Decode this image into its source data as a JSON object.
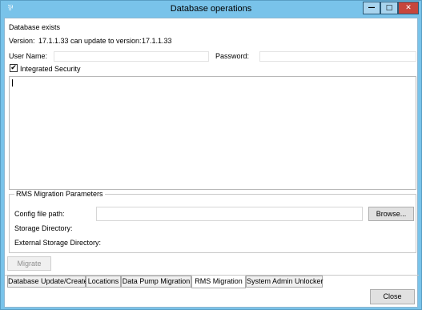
{
  "window": {
    "title": "Database operations",
    "icon_glyph": "⅌",
    "controls": {
      "minimize": "—",
      "maximize": "□",
      "close": "✕"
    }
  },
  "status": {
    "text": "Database exists",
    "version_label": "Version:",
    "version": "17.1.1.33",
    "update_label": "can update to version:",
    "update_version": "17.1.1.33"
  },
  "credentials": {
    "user_name_label": "User Name:",
    "user_name_value": "",
    "password_label": "Password:",
    "password_value": "",
    "integrated_security_label": "Integrated Security",
    "integrated_security_checked": true,
    "check_glyph": "✔"
  },
  "log": {
    "text": ""
  },
  "rms": {
    "group_title": "RMS Migration Parameters",
    "config_path_label": "Config file path:",
    "config_path_value": "",
    "browse_label": "Browse...",
    "storage_dir_label": "Storage Directory:",
    "external_storage_label": "External Storage Directory:",
    "migrate_label": "Migrate"
  },
  "tabs": [
    {
      "label": "Database Update/Create",
      "active": false
    },
    {
      "label": "Locations",
      "active": false
    },
    {
      "label": "Data Pump Migration",
      "active": false
    },
    {
      "label": "RMS Migration",
      "active": true
    },
    {
      "label": "System Admin Unlocker",
      "active": false
    }
  ],
  "footer": {
    "close_label": "Close"
  },
  "colors": {
    "title_bar": "#79c3ea",
    "close_button": "#c7463c"
  }
}
